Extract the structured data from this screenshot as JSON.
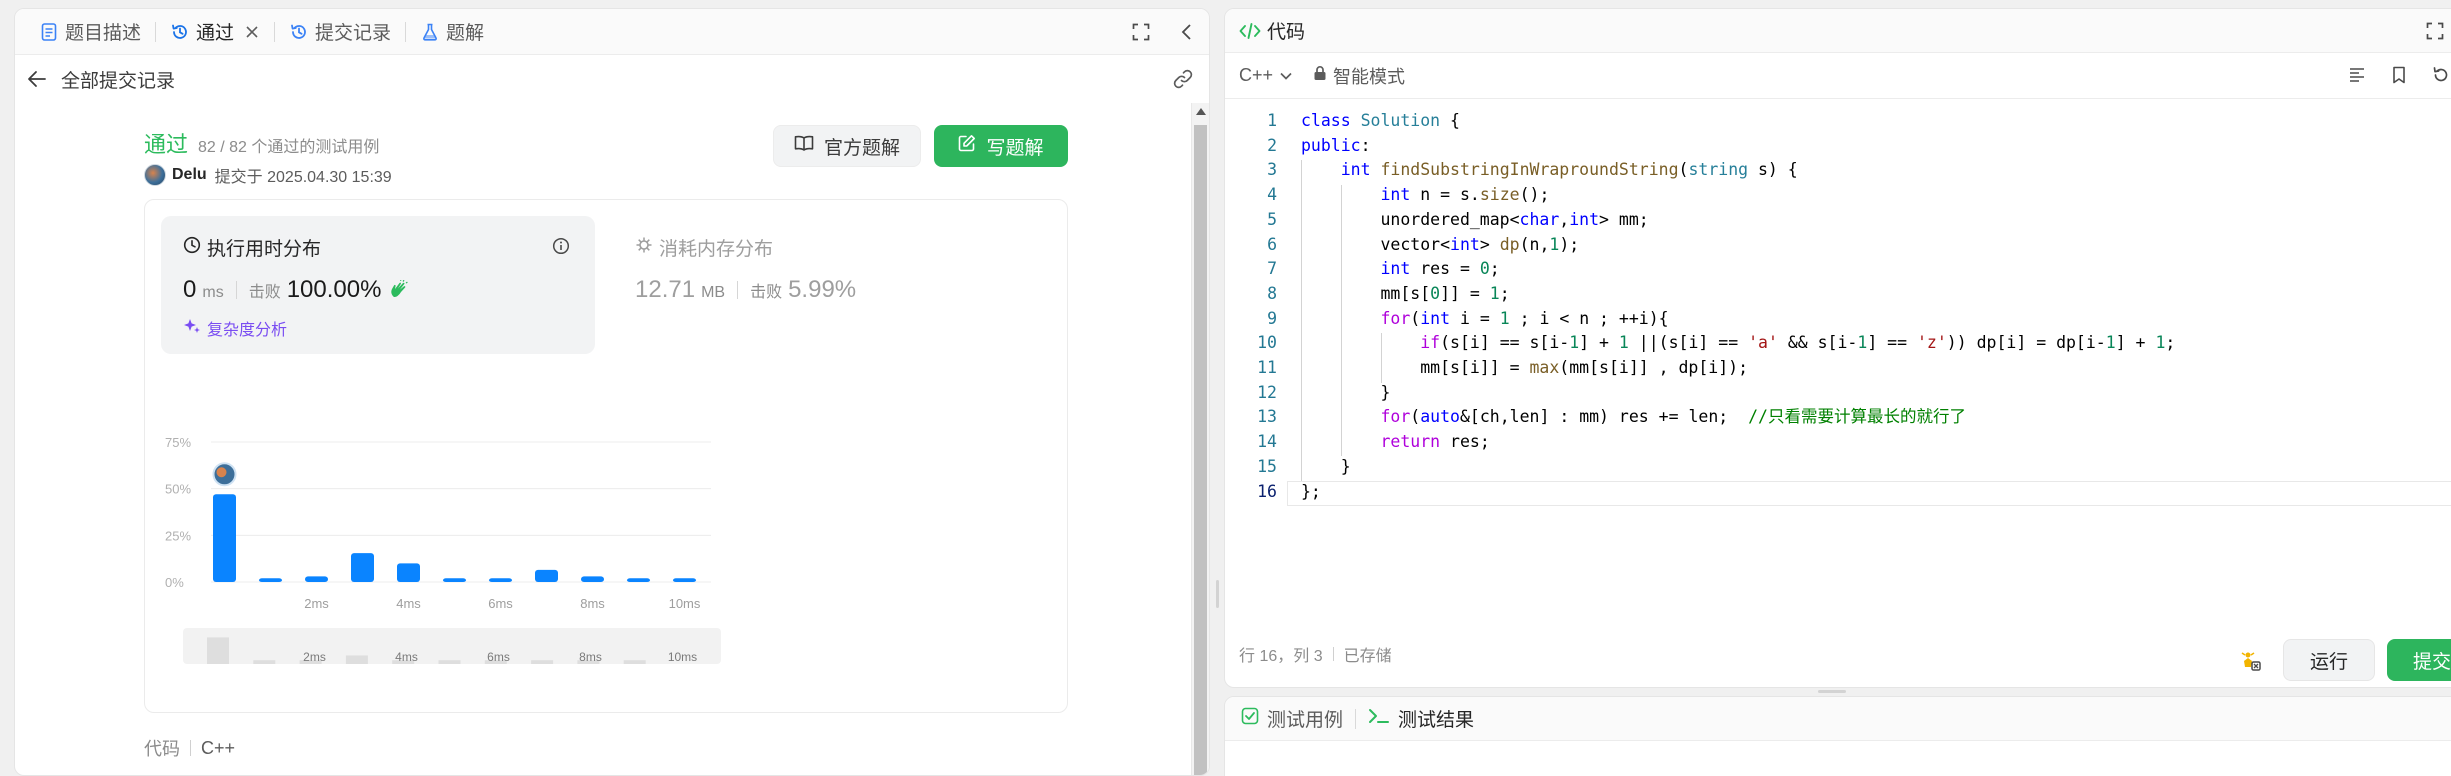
{
  "left": {
    "tabs": [
      {
        "label": "题目描述",
        "icon": "document-icon"
      },
      {
        "label": "通过",
        "icon": "history-icon",
        "active": true,
        "closable": true
      },
      {
        "label": "提交记录",
        "icon": "history-icon"
      },
      {
        "label": "题解",
        "icon": "flask-icon"
      }
    ],
    "back_label": "全部提交记录",
    "status": {
      "result": "通过",
      "testcases": "82 / 82 个通过的测试用例",
      "author": "Delu",
      "submitted_at": "提交于 2025.04.30 15:39"
    },
    "buttons": {
      "official_solution": "官方题解",
      "write_solution": "写题解"
    },
    "runtime": {
      "title": "执行用时分布",
      "value": "0",
      "unit": "ms",
      "beats_label": "击败",
      "beats": "100.00%",
      "complexity_link": "复杂度分析"
    },
    "memory": {
      "title": "消耗内存分布",
      "value": "12.71",
      "unit": "MB",
      "beats_label": "击败",
      "beats": "5.99%"
    },
    "code_label": "代码",
    "code_lang": "C++"
  },
  "chart_data": {
    "type": "bar",
    "categories": [
      "0ms",
      "1ms",
      "2ms",
      "3ms",
      "4ms",
      "5ms",
      "6ms",
      "7ms",
      "8ms",
      "9ms",
      "10ms"
    ],
    "values": [
      47,
      2,
      3,
      15.5,
      10,
      2,
      2,
      6.5,
      3,
      2,
      2
    ],
    "value_unit": "%",
    "ylim": [
      0,
      75
    ],
    "yticks": [
      "75%",
      "50%",
      "25%",
      "0%"
    ],
    "ytick_values": [
      75,
      50,
      25,
      0
    ],
    "xtick_labels": [
      "2ms",
      "4ms",
      "6ms",
      "8ms",
      "10ms"
    ],
    "xtick_indices": [
      2,
      4,
      6,
      8,
      10
    ],
    "overview_values": [
      14,
      2,
      2,
      4.5,
      2,
      2,
      2,
      2,
      2,
      2
    ],
    "highlight_index": 0,
    "bar_color": "#0a84ff",
    "grid": true
  },
  "right": {
    "header_title": "代码",
    "lang": "C++",
    "mode": "智能模式",
    "code_lines": [
      "class Solution {",
      "public:",
      "    int findSubstringInWraproundString(string s) {",
      "        int n = s.size();",
      "        unordered_map<char,int> mm;",
      "        vector<int> dp(n,1);",
      "        int res = 0;",
      "        mm[s[0]] = 1;",
      "        for(int i = 1 ; i < n ; ++i){",
      "            if(s[i] == s[i-1] + 1 ||(s[i] == 'a' && s[i-1] == 'z')) dp[i] = dp[i-1] + 1;",
      "            mm[s[i]] = max(mm[s[i]] , dp[i]);",
      "        }",
      "        for(auto&[ch,len] : mm) res += len;  //只看需要计算最长的就行了",
      "        return res;",
      "    }",
      "};"
    ],
    "cursor_pos": "行 16，列 3",
    "saved": "已存储",
    "run_label": "运行",
    "submit_label": "提交",
    "tests": [
      {
        "label": "测试用例",
        "icon": "checkbox-icon"
      },
      {
        "label": "测试结果",
        "icon": "terminal-icon",
        "active": true
      }
    ]
  }
}
